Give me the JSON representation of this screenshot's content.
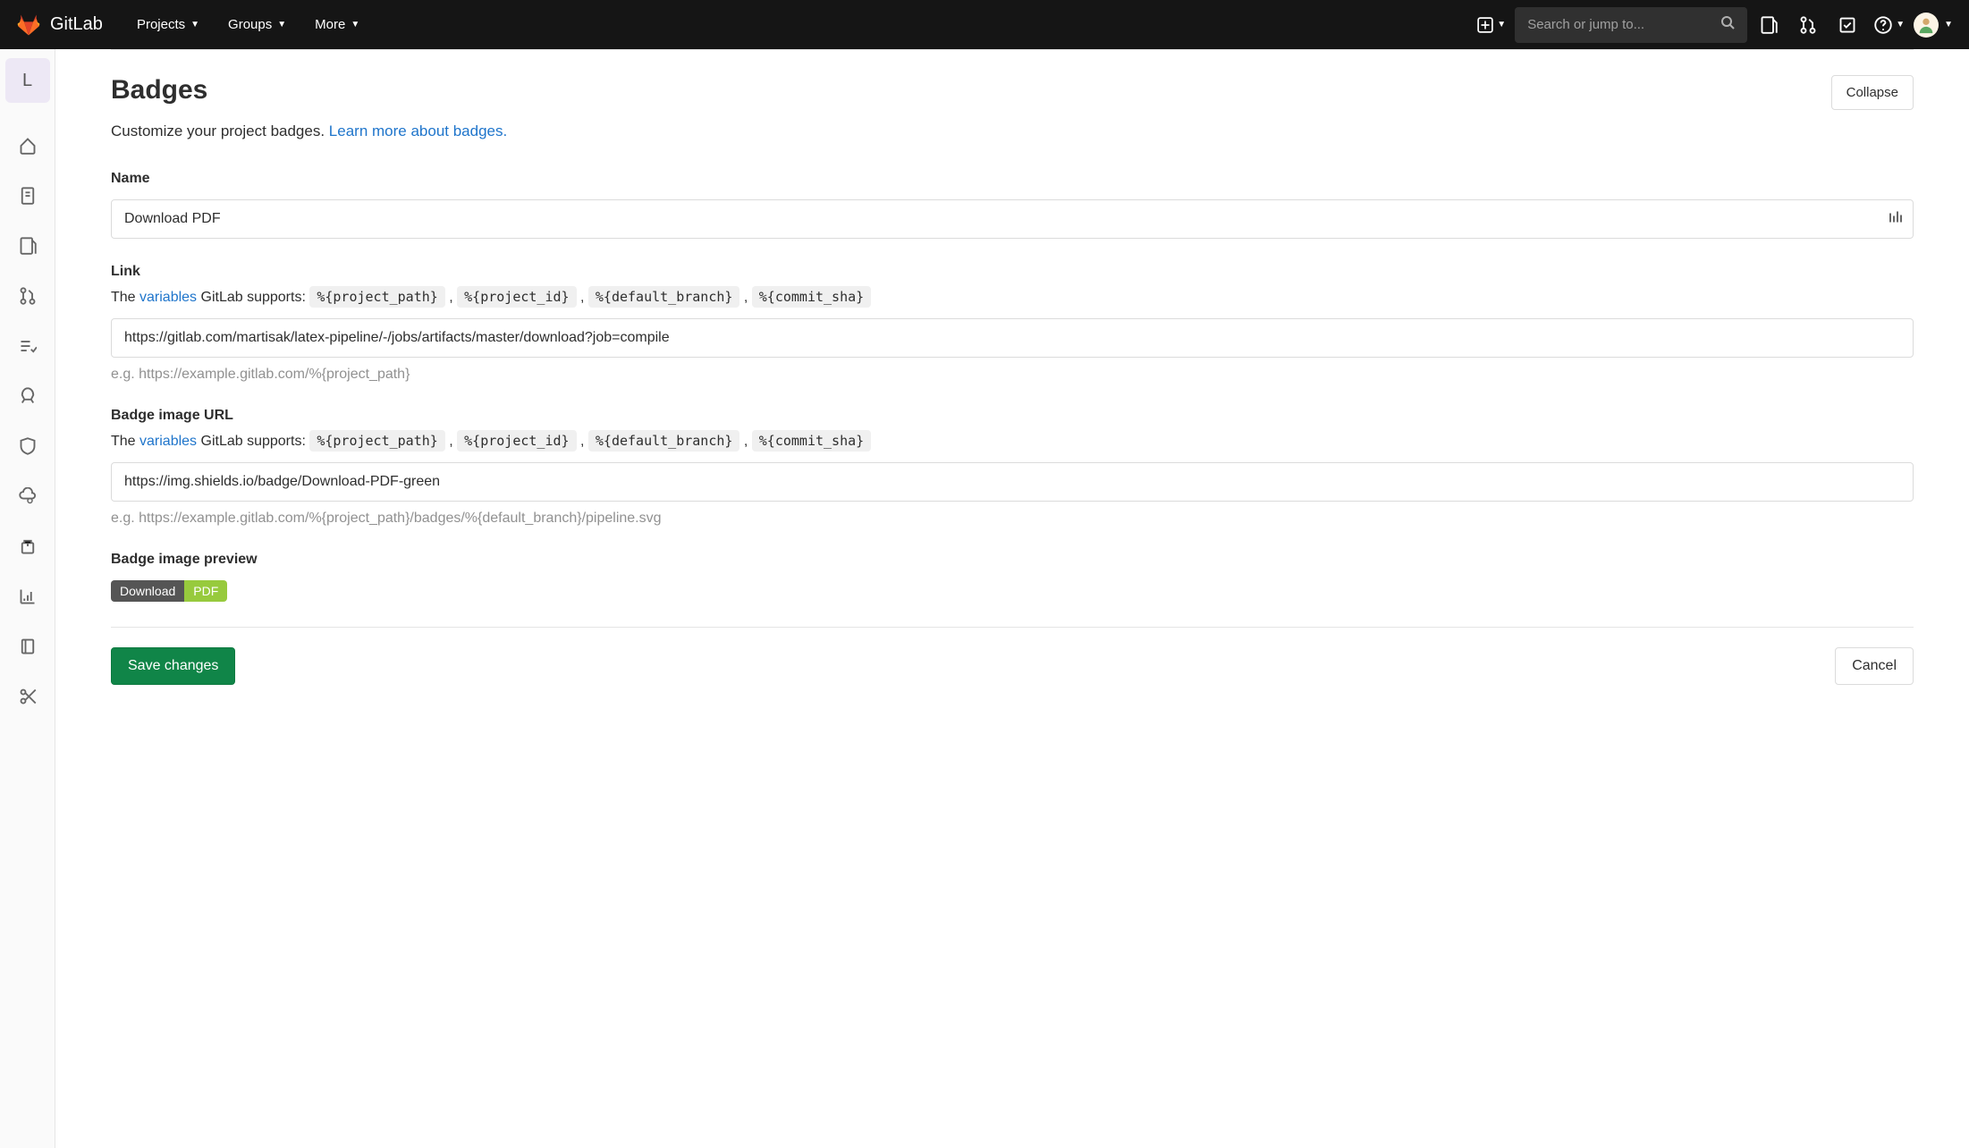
{
  "brand": "GitLab",
  "nav": {
    "items": [
      "Projects",
      "Groups",
      "More"
    ],
    "search_placeholder": "Search or jump to..."
  },
  "project": {
    "letter": "L"
  },
  "section": {
    "title": "Badges",
    "collapse": "Collapse",
    "description_pre": "Customize your project badges. ",
    "description_link": "Learn more about badges."
  },
  "form": {
    "name_label": "Name",
    "name_value": "Download PDF",
    "link_label": "Link",
    "vars_pre": "The ",
    "vars_link": "variables",
    "vars_post": " GitLab supports: ",
    "vars": [
      "%{project_path}",
      "%{project_id}",
      "%{default_branch}",
      "%{commit_sha}"
    ],
    "link_value": "https://gitlab.com/martisak/latex-pipeline/-/jobs/artifacts/master/download?job=compile",
    "link_example": "e.g. https://example.gitlab.com/%{project_path}",
    "image_label": "Badge image URL",
    "image_value": "https://img.shields.io/badge/Download-PDF-green",
    "image_example": "e.g. https://example.gitlab.com/%{project_path}/badges/%{default_branch}/pipeline.svg",
    "preview_label": "Badge image preview",
    "preview_left": "Download",
    "preview_right": "PDF",
    "save": "Save changes",
    "cancel": "Cancel"
  }
}
